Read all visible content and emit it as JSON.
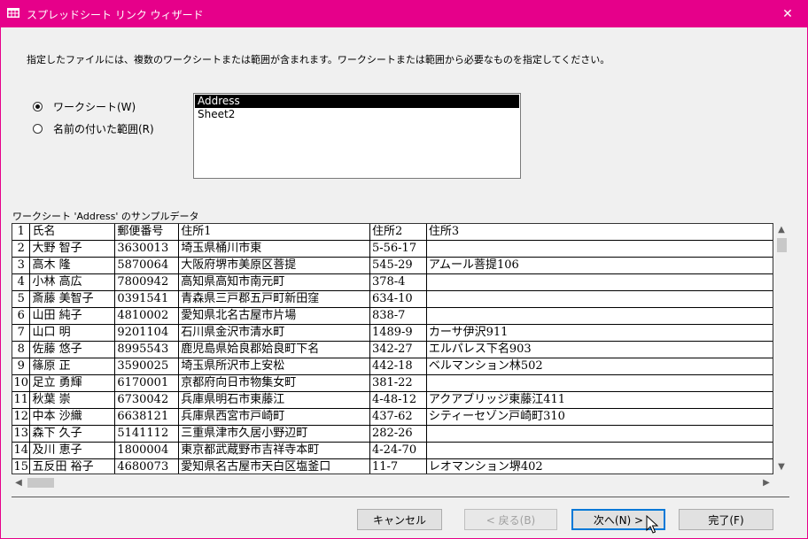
{
  "window": {
    "title": "スプレッドシート リンク ウィザード",
    "title_bar_color": "#e6008a",
    "close_glyph": "✕"
  },
  "instruction": "指定したファイルには、複数のワークシートまたは範囲が含まれます。ワークシートまたは範囲から必要なものを指定してください。",
  "options": {
    "worksheet_label": "ワークシート(W)",
    "named_range_label": "名前の付いた範囲(R)",
    "selected": "worksheet"
  },
  "sheet_list": {
    "items": [
      "Address",
      "Sheet2"
    ],
    "selected": "Address"
  },
  "sample": {
    "label": "ワークシート 'Address' のサンプルデータ",
    "rows": [
      [
        "1",
        "氏名",
        "郵便番号",
        "住所1",
        "住所2",
        "住所3"
      ],
      [
        "2",
        "大野 智子",
        "3630013",
        "埼玉県桶川市東",
        "5-56-17",
        ""
      ],
      [
        "3",
        "高木 隆",
        "5870064",
        "大阪府堺市美原区菩提",
        "545-29",
        "アムール菩提106"
      ],
      [
        "4",
        "小林 高広",
        "7800942",
        "高知県高知市南元町",
        "378-4",
        ""
      ],
      [
        "5",
        "斎藤 美智子",
        "0391541",
        "青森県三戸郡五戸町新田窪",
        "634-10",
        ""
      ],
      [
        "6",
        "山田 純子",
        "4810002",
        "愛知県北名古屋市片場",
        "838-7",
        ""
      ],
      [
        "7",
        "山口 明",
        "9201104",
        "石川県金沢市清水町",
        "1489-9",
        "カーサ伊沢911"
      ],
      [
        "8",
        "佐藤 悠子",
        "8995543",
        "鹿児島県姶良郡姶良町下名",
        "342-27",
        "エルパレス下名903"
      ],
      [
        "9",
        "篠原 正",
        "3590025",
        "埼玉県所沢市上安松",
        "442-18",
        "ベルマンション林502"
      ],
      [
        "10",
        "足立 勇輝",
        "6170001",
        "京都府向日市物集女町",
        "381-22",
        ""
      ],
      [
        "11",
        "秋葉 崇",
        "6730042",
        "兵庫県明石市東藤江",
        "4-48-12",
        "アクアブリッジ東藤江411"
      ],
      [
        "12",
        "中本 沙織",
        "6638121",
        "兵庫県西宮市戸崎町",
        "437-62",
        "シティーセゾン戸崎町310"
      ],
      [
        "13",
        "森下 久子",
        "5141112",
        "三重県津市久居小野辺町",
        "282-26",
        ""
      ],
      [
        "14",
        "及川 恵子",
        "1800004",
        "東京都武蔵野市吉祥寺本町",
        "4-24-70",
        ""
      ],
      [
        "15",
        "五反田 裕子",
        "4680073",
        "愛知県名古屋市天白区塩釜口",
        "11-7",
        "レオマンション堺402"
      ]
    ]
  },
  "buttons": {
    "cancel": "キャンセル",
    "back": "< 戻る(B)",
    "next": "次へ(N) >",
    "finish": "完了(F)"
  }
}
